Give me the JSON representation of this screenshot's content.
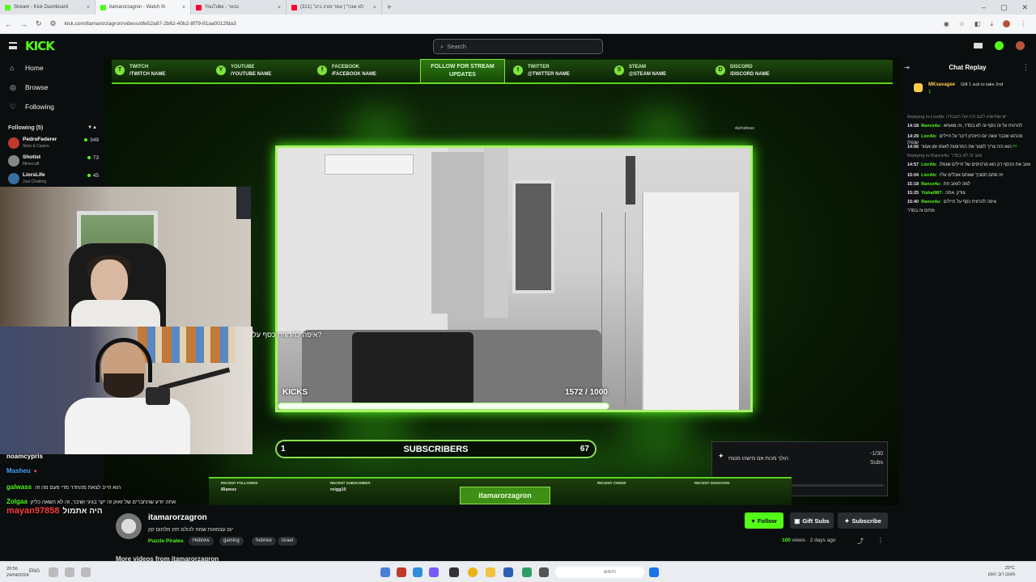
{
  "browser": {
    "tabs": [
      {
        "title": "Stream - Kick Dashboard",
        "color": "#53fc18"
      },
      {
        "title": "itamarorzagron - Watch th",
        "color": "#53fc18"
      },
      {
        "title": "YouTube - נבאר",
        "color": "#ff0033"
      },
      {
        "title": "(311) \"לא שנה\" | עמר מורג ביט",
        "color": "#ff0033"
      }
    ],
    "url": "kick.com/itamarorzagron/videos/dfe52a87-2b62-40b2-8f79-81aa0012fda3"
  },
  "header": {
    "logo": "KICK",
    "search_placeholder": "Search"
  },
  "sidebar": {
    "nav": [
      {
        "label": "Home",
        "icon": "home-icon"
      },
      {
        "label": "Browse",
        "icon": "compass-icon"
      },
      {
        "label": "Following",
        "icon": "heart-icon"
      }
    ],
    "following_title": "Following (5)",
    "channels": [
      {
        "name": "PedroFederer",
        "category": "Slots & Casino",
        "viewers": "349",
        "avatar_color": "#c0392b"
      },
      {
        "name": "Shotist",
        "category": "Minecraft",
        "viewers": "73",
        "avatar_color": "#888888"
      },
      {
        "name": "LiorsLife",
        "category": "Just Chatting",
        "viewers": "45",
        "avatar_color": "#3a6fa0"
      }
    ]
  },
  "overlay": {
    "socials": [
      {
        "platform": "TWITCH",
        "handle": "/TWITCH NAME",
        "glyph": "T"
      },
      {
        "platform": "YOUTUBE",
        "handle": "/YOUTUBE NAME",
        "glyph": "Y"
      },
      {
        "platform": "FACEBOOK",
        "handle": "/FACEBOOK NAME",
        "glyph": "f"
      }
    ],
    "socials_right": [
      {
        "platform": "TWITTER",
        "handle": "@TWITTER NAME",
        "glyph": "t"
      },
      {
        "platform": "STEAM",
        "handle": "@STEAM NAME",
        "glyph": "S"
      },
      {
        "platform": "DISCORD",
        "handle": "/DISCORD NAME",
        "glyph": "D"
      }
    ],
    "follow_banner": "FOLLOW FOR STREAM UPDATES",
    "darkid": "darkideas",
    "kicks_label": "KICKS",
    "kicks_count": "1572 / 1000",
    "kicks_progress": 1.0,
    "donation_text": "איפה להרוויח כסף על?",
    "subs_label": "SUBSCRIBERS",
    "subs_start": "1",
    "subs_count": "67",
    "goal_text": "הולך מכות אם מישהו מנצח",
    "goal_count": "-1/30",
    "goal_unit": "Subs",
    "goal_progress": 0.0,
    "bottom_labels": {
      "recent_follower": "RECENT FOLLOWER",
      "follower_name": "lRamez",
      "recent_sub": "RECENT SUBSCRIBER",
      "sub_name": "reigg10",
      "recent_cheer": "RECENT CHEER",
      "recent_donation": "RECENT DONATION"
    },
    "channel_plate": "itamarorzagron"
  },
  "overlay_chat": [
    {
      "user": "noamcypris",
      "color": "#ffffff",
      "msg": ""
    },
    {
      "user": "Masheu",
      "color": "#4fa3ff",
      "msg": "♥"
    },
    {
      "user": "galwass",
      "color": "#53fc18",
      "msg": "הוא חייב לצאת מהחדר מדי פעם מה זה"
    },
    {
      "user": "Zolgaa",
      "color": "#53fc18",
      "msg": "אתה יודע שהחברים של זאוק זה יקר בגיגי ושיבר, זה לא השאה כליק"
    },
    {
      "user": "mayan97858",
      "color": "#ff3b3b",
      "msg": "איך היה אתמול?"
    }
  ],
  "chat": {
    "title": "Chat Replay",
    "pinned": {
      "user": "MKsavagee",
      "msg": "Gift 1 sub to take 2nd",
      "count": "1"
    },
    "lines": [
      {
        "type": "reply",
        "text": "Replying to LiorAb: יש שמישהו ליגם היה את העבודה"
      },
      {
        "time": "14:18",
        "user": "Rance4u:",
        "text": "להרוויח על זה כסף זה לא בסדר, זה מאוחא"
      },
      {
        "time": "",
        "user": "",
        "text": ""
      },
      {
        "time": "14:29",
        "user": "LiorAb:",
        "text": "מהרגע שכבר עשה יום היזכרון דיבר על חיילים שנפלו"
      },
      {
        "time": "",
        "user": "",
        "text": ""
      },
      {
        "time": "14:56",
        "user": "ייי:",
        "text": "הוא היה צריך לסגור את התרומות לאותו זמן אמור"
      },
      {
        "type": "reply",
        "text": "Replying to Rance4u: אגב זה לא בסדר"
      },
      {
        "time": "14:57",
        "user": "LiorAb:",
        "text": "עזוב את הכסף רק הוא מרטיסים של חיילים שנפלו"
      },
      {
        "time": "",
        "user": "",
        "text": ""
      },
      {
        "time": "15:04",
        "user": "LiorAb:",
        "text": "זה סתם תסביך שאתם אוכלים עליו"
      },
      {
        "time": "15:18",
        "user": "Rance4u:",
        "text": "למה לעזוב חח"
      },
      {
        "time": "15:25",
        "user": "Yishai987:",
        "text": "צודק .אתה"
      },
      {
        "time": "15:40",
        "user": "Rance4u:",
        "text": "איפה להרוויח כסף על חיילים"
      },
      {
        "time": "",
        "user": "",
        "text": "מתים זה בסדר"
      }
    ]
  },
  "info": {
    "streamer": "itamarorzagron",
    "title": "יום עצמאות שמח לכולם חוץ מלחום קק",
    "category": "Puzzle Pirates",
    "tags": [
      "Hebrew",
      "gaming",
      "hebrew",
      "israel"
    ],
    "follow": "Follow",
    "gift": "Gift Subs",
    "subscribe": "Subscribe",
    "views_num": "100",
    "views_rest": "views · 2 days ago",
    "more_videos": "More videos from itamarorzagron"
  },
  "taskbar": {
    "time": "20:56",
    "date": "24/04/2024",
    "lang": "ENG",
    "search": "חיפוש",
    "temp": "20°C",
    "weather": "מעונן רוב הזמן"
  },
  "colors": {
    "accent": "#53fc18",
    "bg": "#0b0e0f"
  }
}
